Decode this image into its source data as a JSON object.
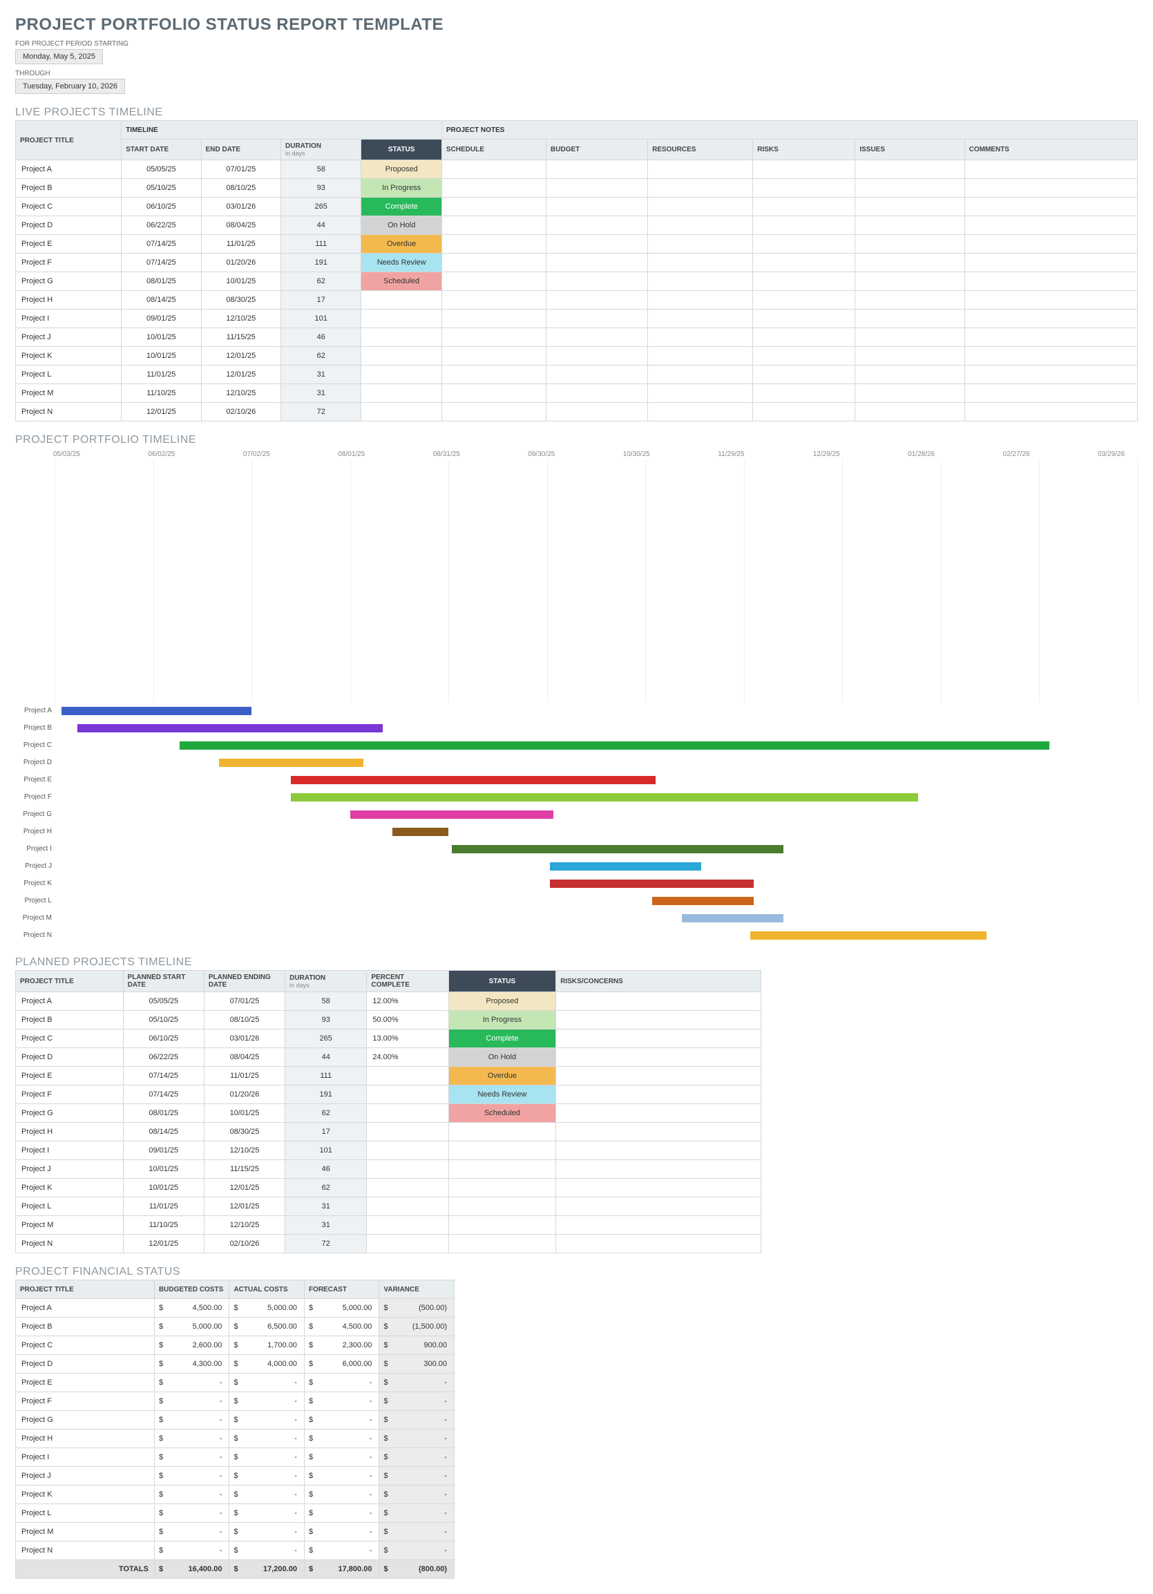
{
  "title": "PROJECT PORTFOLIO STATUS REPORT TEMPLATE",
  "period": {
    "start_label": "FOR PROJECT PERIOD STARTING",
    "start_value": "Monday, May 5, 2025",
    "end_label": "THROUGH",
    "end_value": "Tuesday, February 10, 2026"
  },
  "sections": {
    "live_head": "LIVE PROJECTS TIMELINE",
    "timeline_head": "PROJECT PORTFOLIO TIMELINE",
    "planned_head": "PLANNED PROJECTS TIMELINE",
    "financial_head": "PROJECT FINANCIAL STATUS"
  },
  "live_table": {
    "group_timeline": "TIMELINE",
    "group_notes": "PROJECT NOTES",
    "headers": {
      "title": "PROJECT TITLE",
      "start": "START DATE",
      "end": "END DATE",
      "duration": "DURATION",
      "duration_sub": "in days",
      "status": "STATUS",
      "schedule": "SCHEDULE",
      "budget": "BUDGET",
      "resources": "RESOURCES",
      "risks": "RISKS",
      "issues": "ISSUES",
      "comments": "COMMENTS"
    },
    "rows": [
      {
        "title": "Project A",
        "start": "05/05/25",
        "end": "07/01/25",
        "dur": "58",
        "status": "Proposed",
        "cls": "s-proposed"
      },
      {
        "title": "Project B",
        "start": "05/10/25",
        "end": "08/10/25",
        "dur": "93",
        "status": "In Progress",
        "cls": "s-inprog"
      },
      {
        "title": "Project C",
        "start": "06/10/25",
        "end": "03/01/26",
        "dur": "265",
        "status": "Complete",
        "cls": "s-complete"
      },
      {
        "title": "Project D",
        "start": "06/22/25",
        "end": "08/04/25",
        "dur": "44",
        "status": "On Hold",
        "cls": "s-hold"
      },
      {
        "title": "Project E",
        "start": "07/14/25",
        "end": "11/01/25",
        "dur": "111",
        "status": "Overdue",
        "cls": "s-overdue"
      },
      {
        "title": "Project F",
        "start": "07/14/25",
        "end": "01/20/26",
        "dur": "191",
        "status": "Needs Review",
        "cls": "s-review"
      },
      {
        "title": "Project G",
        "start": "08/01/25",
        "end": "10/01/25",
        "dur": "62",
        "status": "Scheduled",
        "cls": "s-scheduled"
      },
      {
        "title": "Project H",
        "start": "08/14/25",
        "end": "08/30/25",
        "dur": "17",
        "status": "",
        "cls": ""
      },
      {
        "title": "Project I",
        "start": "09/01/25",
        "end": "12/10/25",
        "dur": "101",
        "status": "",
        "cls": ""
      },
      {
        "title": "Project J",
        "start": "10/01/25",
        "end": "11/15/25",
        "dur": "46",
        "status": "",
        "cls": ""
      },
      {
        "title": "Project K",
        "start": "10/01/25",
        "end": "12/01/25",
        "dur": "62",
        "status": "",
        "cls": ""
      },
      {
        "title": "Project L",
        "start": "11/01/25",
        "end": "12/01/25",
        "dur": "31",
        "status": "",
        "cls": ""
      },
      {
        "title": "Project M",
        "start": "11/10/25",
        "end": "12/10/25",
        "dur": "31",
        "status": "",
        "cls": ""
      },
      {
        "title": "Project N",
        "start": "12/01/25",
        "end": "02/10/26",
        "dur": "72",
        "status": "",
        "cls": ""
      }
    ]
  },
  "chart_data": {
    "type": "bar",
    "orientation": "horizontal-gantt",
    "x_axis_ticks": [
      "05/03/25",
      "06/02/25",
      "07/02/25",
      "08/01/25",
      "08/31/25",
      "09/30/25",
      "10/30/25",
      "11/29/25",
      "12/29/25",
      "01/28/26",
      "02/27/26",
      "03/29/26"
    ],
    "x_range_days": [
      0,
      330
    ],
    "series": [
      {
        "name": "Project A",
        "start_day": 2,
        "dur": 58,
        "color": "#3b61c9"
      },
      {
        "name": "Project B",
        "start_day": 7,
        "dur": 93,
        "color": "#7a37d6"
      },
      {
        "name": "Project C",
        "start_day": 38,
        "dur": 265,
        "color": "#1fa83e"
      },
      {
        "name": "Project D",
        "start_day": 50,
        "dur": 44,
        "color": "#f0b32e"
      },
      {
        "name": "Project E",
        "start_day": 72,
        "dur": 111,
        "color": "#d82a2a"
      },
      {
        "name": "Project F",
        "start_day": 72,
        "dur": 191,
        "color": "#8ecb3c"
      },
      {
        "name": "Project G",
        "start_day": 90,
        "dur": 62,
        "color": "#e03da5"
      },
      {
        "name": "Project H",
        "start_day": 103,
        "dur": 17,
        "color": "#8a5a1e"
      },
      {
        "name": "Project I",
        "start_day": 121,
        "dur": 101,
        "color": "#4b7b2e"
      },
      {
        "name": "Project J",
        "start_day": 151,
        "dur": 46,
        "color": "#2aa7d6"
      },
      {
        "name": "Project K",
        "start_day": 151,
        "dur": 62,
        "color": "#c62f2f"
      },
      {
        "name": "Project L",
        "start_day": 182,
        "dur": 31,
        "color": "#c8651a"
      },
      {
        "name": "Project M",
        "start_day": 191,
        "dur": 31,
        "color": "#9ab9df"
      },
      {
        "name": "Project N",
        "start_day": 212,
        "dur": 72,
        "color": "#f0b32e"
      }
    ]
  },
  "planned_table": {
    "headers": {
      "title": "PROJECT TITLE",
      "start": "PLANNED START DATE",
      "end": "PLANNED ENDING DATE",
      "dur": "DURATION",
      "dur_sub": "in days",
      "pct": "PERCENT COMPLETE",
      "status": "STATUS",
      "risks": "RISKS/CONCERNS"
    },
    "rows": [
      {
        "title": "Project A",
        "start": "05/05/25",
        "end": "07/01/25",
        "dur": "58",
        "pct": "12.00%",
        "status": "Proposed",
        "cls": "s-proposed"
      },
      {
        "title": "Project B",
        "start": "05/10/25",
        "end": "08/10/25",
        "dur": "93",
        "pct": "50.00%",
        "status": "In Progress",
        "cls": "s-inprog"
      },
      {
        "title": "Project C",
        "start": "06/10/25",
        "end": "03/01/26",
        "dur": "265",
        "pct": "13.00%",
        "status": "Complete",
        "cls": "s-complete"
      },
      {
        "title": "Project D",
        "start": "06/22/25",
        "end": "08/04/25",
        "dur": "44",
        "pct": "24.00%",
        "status": "On Hold",
        "cls": "s-hold"
      },
      {
        "title": "Project E",
        "start": "07/14/25",
        "end": "11/01/25",
        "dur": "111",
        "pct": "",
        "status": "Overdue",
        "cls": "s-overdue"
      },
      {
        "title": "Project F",
        "start": "07/14/25",
        "end": "01/20/26",
        "dur": "191",
        "pct": "",
        "status": "Needs Review",
        "cls": "s-review"
      },
      {
        "title": "Project G",
        "start": "08/01/25",
        "end": "10/01/25",
        "dur": "62",
        "pct": "",
        "status": "Scheduled",
        "cls": "s-scheduled"
      },
      {
        "title": "Project H",
        "start": "08/14/25",
        "end": "08/30/25",
        "dur": "17",
        "pct": "",
        "status": "",
        "cls": ""
      },
      {
        "title": "Project I",
        "start": "09/01/25",
        "end": "12/10/25",
        "dur": "101",
        "pct": "",
        "status": "",
        "cls": ""
      },
      {
        "title": "Project J",
        "start": "10/01/25",
        "end": "11/15/25",
        "dur": "46",
        "pct": "",
        "status": "",
        "cls": ""
      },
      {
        "title": "Project K",
        "start": "10/01/25",
        "end": "12/01/25",
        "dur": "62",
        "pct": "",
        "status": "",
        "cls": ""
      },
      {
        "title": "Project L",
        "start": "11/01/25",
        "end": "12/01/25",
        "dur": "31",
        "pct": "",
        "status": "",
        "cls": ""
      },
      {
        "title": "Project M",
        "start": "11/10/25",
        "end": "12/10/25",
        "dur": "31",
        "pct": "",
        "status": "",
        "cls": ""
      },
      {
        "title": "Project N",
        "start": "12/01/25",
        "end": "02/10/26",
        "dur": "72",
        "pct": "",
        "status": "",
        "cls": ""
      }
    ]
  },
  "fin_table": {
    "headers": {
      "title": "PROJECT TITLE",
      "budget": "BUDGETED COSTS",
      "actual": "ACTUAL COSTS",
      "forecast": "FORECAST",
      "variance": "VARIANCE"
    },
    "rows": [
      {
        "title": "Project A",
        "b": "4,500.00",
        "a": "5,000.00",
        "f": "5,000.00",
        "v": "(500.00)"
      },
      {
        "title": "Project B",
        "b": "5,000.00",
        "a": "6,500.00",
        "f": "4,500.00",
        "v": "(1,500.00)"
      },
      {
        "title": "Project C",
        "b": "2,600.00",
        "a": "1,700.00",
        "f": "2,300.00",
        "v": "900.00"
      },
      {
        "title": "Project D",
        "b": "4,300.00",
        "a": "4,000.00",
        "f": "6,000.00",
        "v": "300.00"
      },
      {
        "title": "Project E",
        "b": "-",
        "a": "-",
        "f": "-",
        "v": "-"
      },
      {
        "title": "Project F",
        "b": "-",
        "a": "-",
        "f": "-",
        "v": "-"
      },
      {
        "title": "Project G",
        "b": "-",
        "a": "-",
        "f": "-",
        "v": "-"
      },
      {
        "title": "Project H",
        "b": "-",
        "a": "-",
        "f": "-",
        "v": "-"
      },
      {
        "title": "Project I",
        "b": "-",
        "a": "-",
        "f": "-",
        "v": "-"
      },
      {
        "title": "Project J",
        "b": "-",
        "a": "-",
        "f": "-",
        "v": "-"
      },
      {
        "title": "Project K",
        "b": "-",
        "a": "-",
        "f": "-",
        "v": "-"
      },
      {
        "title": "Project L",
        "b": "-",
        "a": "-",
        "f": "-",
        "v": "-"
      },
      {
        "title": "Project M",
        "b": "-",
        "a": "-",
        "f": "-",
        "v": "-"
      },
      {
        "title": "Project N",
        "b": "-",
        "a": "-",
        "f": "-",
        "v": "-"
      }
    ],
    "totals": {
      "label": "TOTALS",
      "b": "16,400.00",
      "a": "17,200.00",
      "f": "17,800.00",
      "v": "(800.00)"
    }
  }
}
